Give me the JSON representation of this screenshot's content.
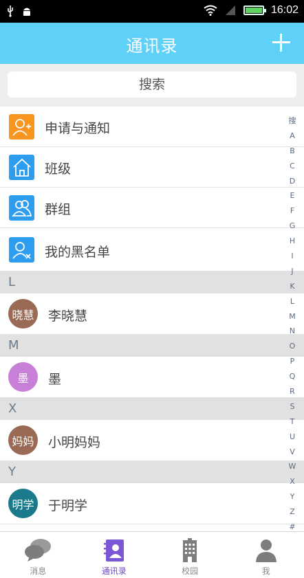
{
  "status_bar": {
    "time": "16:02"
  },
  "header": {
    "title": "通讯录"
  },
  "search": {
    "placeholder": "搜索"
  },
  "functions": [
    {
      "label": "申请与通知",
      "icon": "add-person-icon",
      "color": "#f7951e"
    },
    {
      "label": "班级",
      "icon": "home-icon",
      "color": "#2e9df0"
    },
    {
      "label": "群组",
      "icon": "group-icon",
      "color": "#2e9df0"
    },
    {
      "label": "我的黑名单",
      "icon": "blocked-person-icon",
      "color": "#2e9df0"
    }
  ],
  "sections": [
    {
      "letter": "L",
      "contacts": [
        {
          "avatar_text": "晓慧",
          "name": "李晓慧",
          "color": "#9b6a55"
        }
      ]
    },
    {
      "letter": "M",
      "contacts": [
        {
          "avatar_text": "墨",
          "name": "墨",
          "color": "#c77fd8"
        }
      ]
    },
    {
      "letter": "X",
      "contacts": [
        {
          "avatar_text": "妈妈",
          "name": "小明妈妈",
          "color": "#9b6a55"
        }
      ]
    },
    {
      "letter": "Y",
      "contacts": [
        {
          "avatar_text": "明学",
          "name": "于明学",
          "color": "#1a7a8c"
        }
      ]
    }
  ],
  "index_letters": [
    "搜",
    "A",
    "B",
    "C",
    "D",
    "E",
    "F",
    "G",
    "H",
    "I",
    "J",
    "K",
    "L",
    "M",
    "N",
    "O",
    "P",
    "Q",
    "R",
    "S",
    "T",
    "U",
    "V",
    "W",
    "X",
    "Y",
    "Z",
    "#"
  ],
  "bottom_nav": [
    {
      "label": "消息",
      "icon": "chat-icon",
      "active": false
    },
    {
      "label": "通讯录",
      "icon": "contacts-book-icon",
      "active": true
    },
    {
      "label": "校园",
      "icon": "building-icon",
      "active": false
    },
    {
      "label": "我",
      "icon": "person-icon",
      "active": false
    }
  ],
  "colors": {
    "header": "#5fd0f7",
    "active_nav": "#6c4bc1"
  }
}
